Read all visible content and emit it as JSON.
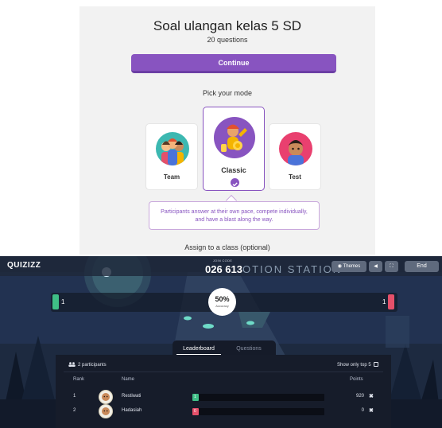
{
  "setup": {
    "quiz_title": "Soal ulangan kelas 5 SD",
    "question_count": "20 questions",
    "continue_label": "Continue",
    "mode_heading": "Pick your mode",
    "modes": [
      {
        "label": "Team",
        "color": "#3cb8b1"
      },
      {
        "label": "Classic",
        "color": "#8854c0",
        "selected": true
      },
      {
        "label": "Test",
        "color": "#e9406f"
      }
    ],
    "mode_description": "Participants answer at their own pace, compete individually, and have a blast along the way.",
    "assign_label": "Assign to a class",
    "assign_optional": "(optional)"
  },
  "live": {
    "brand": "QUIZIZZ",
    "join_label": "JOIN CODE",
    "join_code": "026 613",
    "theme_title": "OTION STATION",
    "themes_label": "Themes",
    "end_label": "End",
    "progress_left_count": "1",
    "progress_right_count": "1",
    "accuracy_value": "50%",
    "accuracy_label": "Accuracy",
    "tabs": [
      "Leaderboard",
      "Questions"
    ],
    "active_tab": "Leaderboard",
    "participants_label": "2 participants",
    "top5_label": "Show only top 5",
    "columns": {
      "rank": "Rank",
      "name": "Name",
      "points": "Points"
    },
    "rows": [
      {
        "rank": "1",
        "name": "Restiwati",
        "correct": "1",
        "points": "920",
        "bar_color": "#3fbe86",
        "bar_fraction": 0.05
      },
      {
        "rank": "2",
        "name": "Hadasiah",
        "correct": "0",
        "points": "0",
        "bar_color": "#e5506a",
        "bar_fraction": 0.05
      }
    ],
    "remove_label": "✖"
  }
}
